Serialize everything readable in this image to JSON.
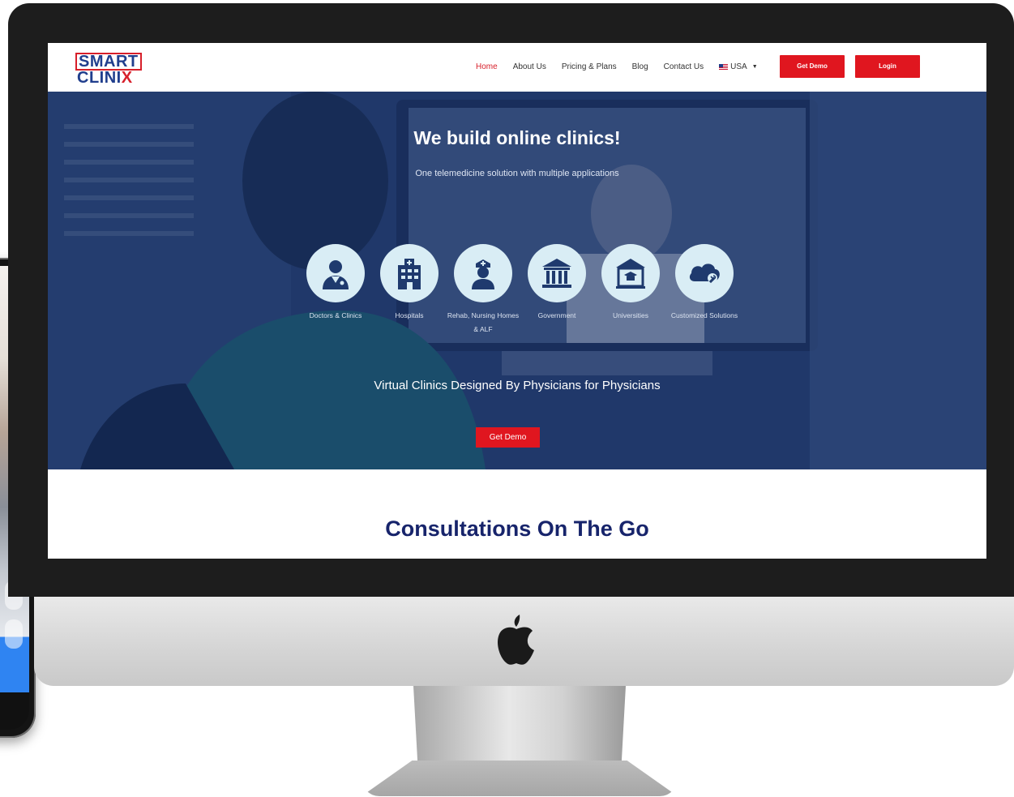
{
  "site": {
    "logo": {
      "line1": "SMART",
      "line2_prefix": "CLINI",
      "line2_suffix": "X"
    }
  },
  "nav": {
    "links": [
      "Home",
      "About Us",
      "Pricing & Plans",
      "Blog",
      "Contact Us"
    ],
    "active": "Home",
    "language": "USA",
    "get_demo_label": "Get Demo",
    "login_label": "Login"
  },
  "hero": {
    "title": "We build online clinics!",
    "subtitle": "One telemedicine solution with multiple applications",
    "services": [
      {
        "label": "Doctors & Clinics",
        "icon": "doctor-icon"
      },
      {
        "label": "Hospitals",
        "icon": "hospital-icon"
      },
      {
        "label": "Rehab, Nursing Homes & ALF",
        "icon": "nurse-icon"
      },
      {
        "label": "Government",
        "icon": "government-building-icon"
      },
      {
        "label": "Universities",
        "icon": "university-icon"
      },
      {
        "label": "Customized Solutions",
        "icon": "cloud-wrench-icon"
      }
    ],
    "tagline": "Virtual Clinics Designed By Physicians for Physicians",
    "cta_label": "Get Demo"
  },
  "section": {
    "title": "Consultations On The Go"
  },
  "colors": {
    "brand_red": "#e0161f",
    "brand_navy": "#17246b",
    "icon_circle": "#d9edf5",
    "icon_navy": "#1f3a6e"
  }
}
